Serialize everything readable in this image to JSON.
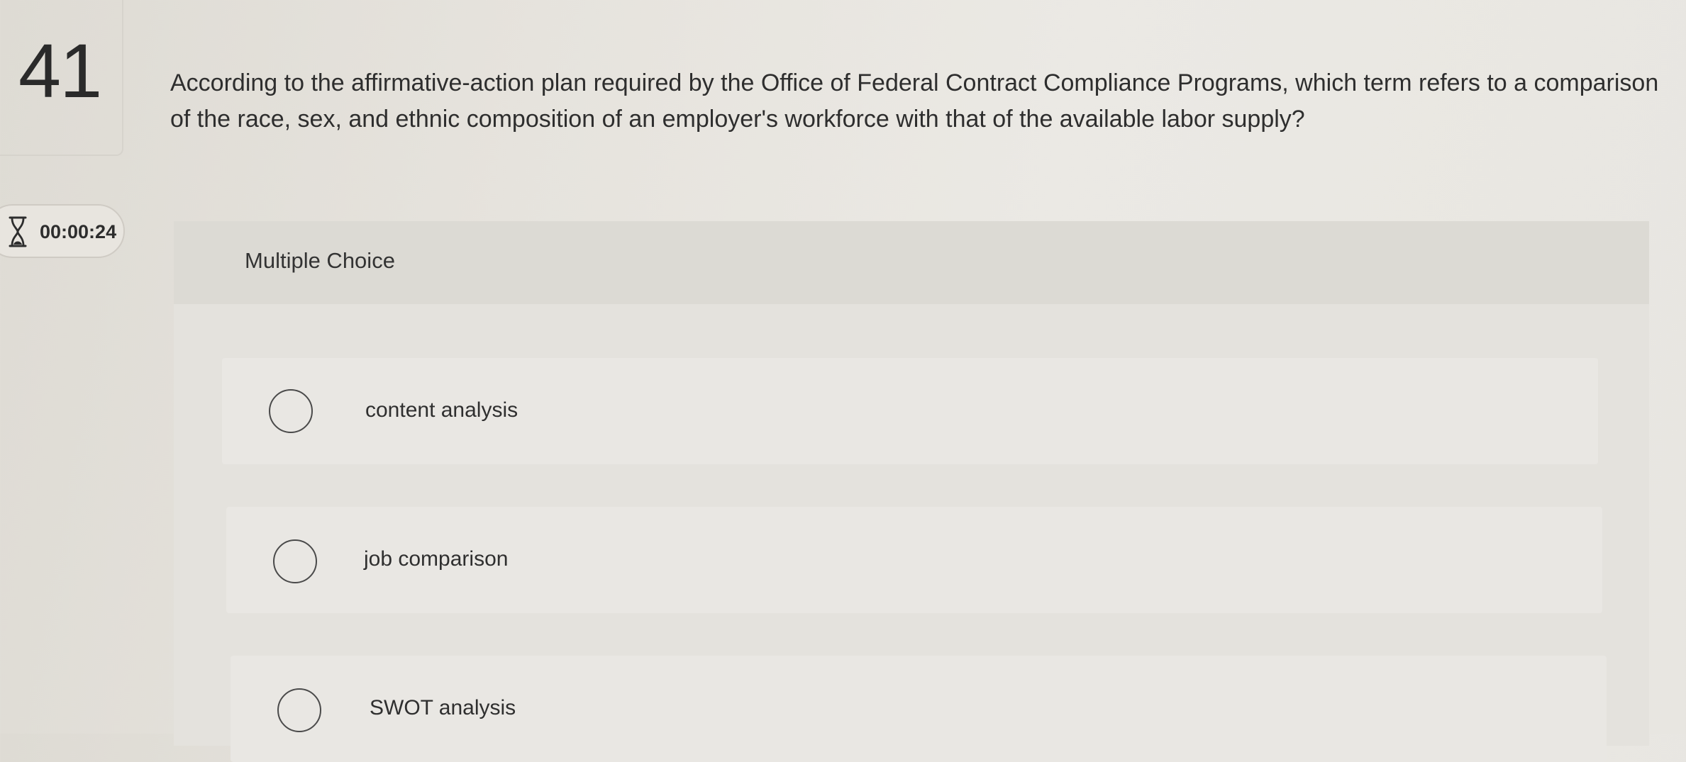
{
  "question": {
    "number": "41",
    "text": "According to the affirmative-action plan required by the Office of Federal Contract Compliance Programs, which term refers to a comparison of the race, sex, and ethnic composition of an employer's workforce with that of the available labor supply?"
  },
  "timer": {
    "icon": "hourglass-icon",
    "value": "00:00:24"
  },
  "multiple_choice": {
    "label": "Multiple Choice",
    "options": [
      {
        "label": "content analysis",
        "selected": false
      },
      {
        "label": "job comparison",
        "selected": false
      },
      {
        "label": "SWOT analysis",
        "selected": false
      }
    ]
  },
  "colors": {
    "background": "#e6e3dd",
    "panel": "#e4e2dd",
    "header": "#dcdad4",
    "text": "#2f2f2f"
  }
}
